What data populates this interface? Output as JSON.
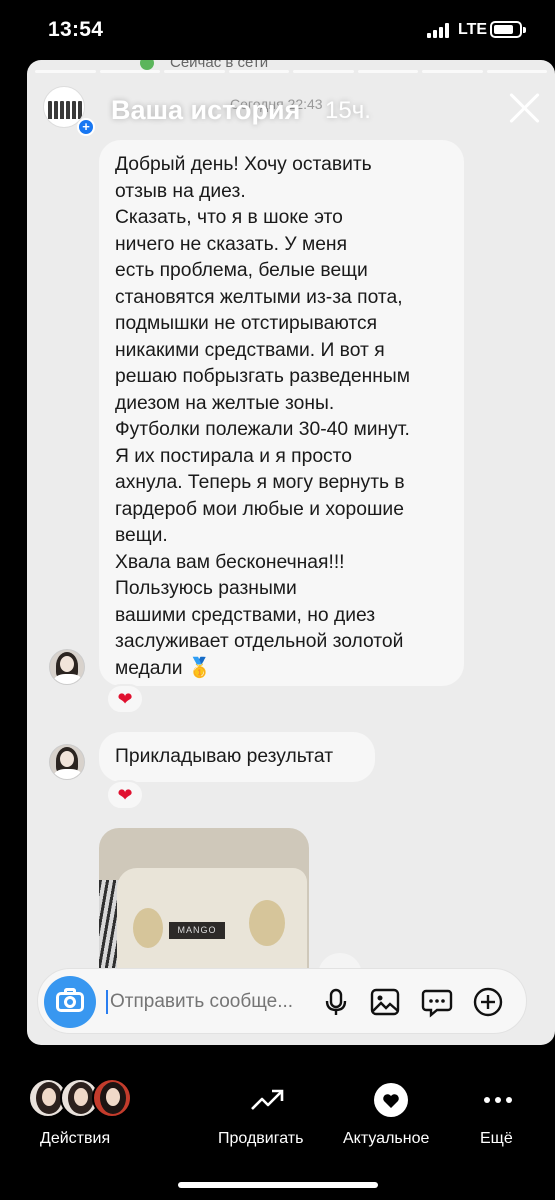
{
  "status_bar": {
    "time": "13:54",
    "network": "LTE"
  },
  "story": {
    "title": "Ваша история",
    "age": "15ч.",
    "timestamp": "Сегодня 22:43",
    "ghost_status": "Сейчас в сети"
  },
  "messages": {
    "review_text": "Добрый день! Хочу оставить\nотзыв на диез.\nСказать, что я в шоке это\nничего не сказать. У меня\nесть проблема, белые вещи\nстановятся желтыми из-за пота,\nподмышки не отстирываются\nникакими средствами. И вот я\nрешаю побрызгать разведенным\nдиезом на желтые зоны.\nФутболки полежали 30-40 минут.\nЯ их постирала и я просто\nахнула. Теперь я могу вернуть в\nгардероб мои любые и хорошие\nвещи.\nХвала вам бесконечная!!!\nПользуюсь разными\nвашими средствами, но диез\nзаслуживает отдельной золотой\nмедали 🥇",
    "result_text": "Прикладываю результат",
    "reaction": "❤",
    "photo_label": "MANGO"
  },
  "input": {
    "placeholder": "Отправить сообще..."
  },
  "bottom_bar": {
    "actions_label": "Действия",
    "promote_label": "Продвигать",
    "highlight_label": "Актуальное",
    "more_label": "Ещё"
  },
  "colors": {
    "accent": "#3897f0",
    "reaction": "#e0102f",
    "badge": "#1877f2"
  },
  "icons": [
    "close-icon",
    "camera-icon",
    "mic-icon",
    "gallery-icon",
    "sticker-icon",
    "plus-icon",
    "trending-up-icon",
    "heart-icon",
    "more-icon"
  ]
}
